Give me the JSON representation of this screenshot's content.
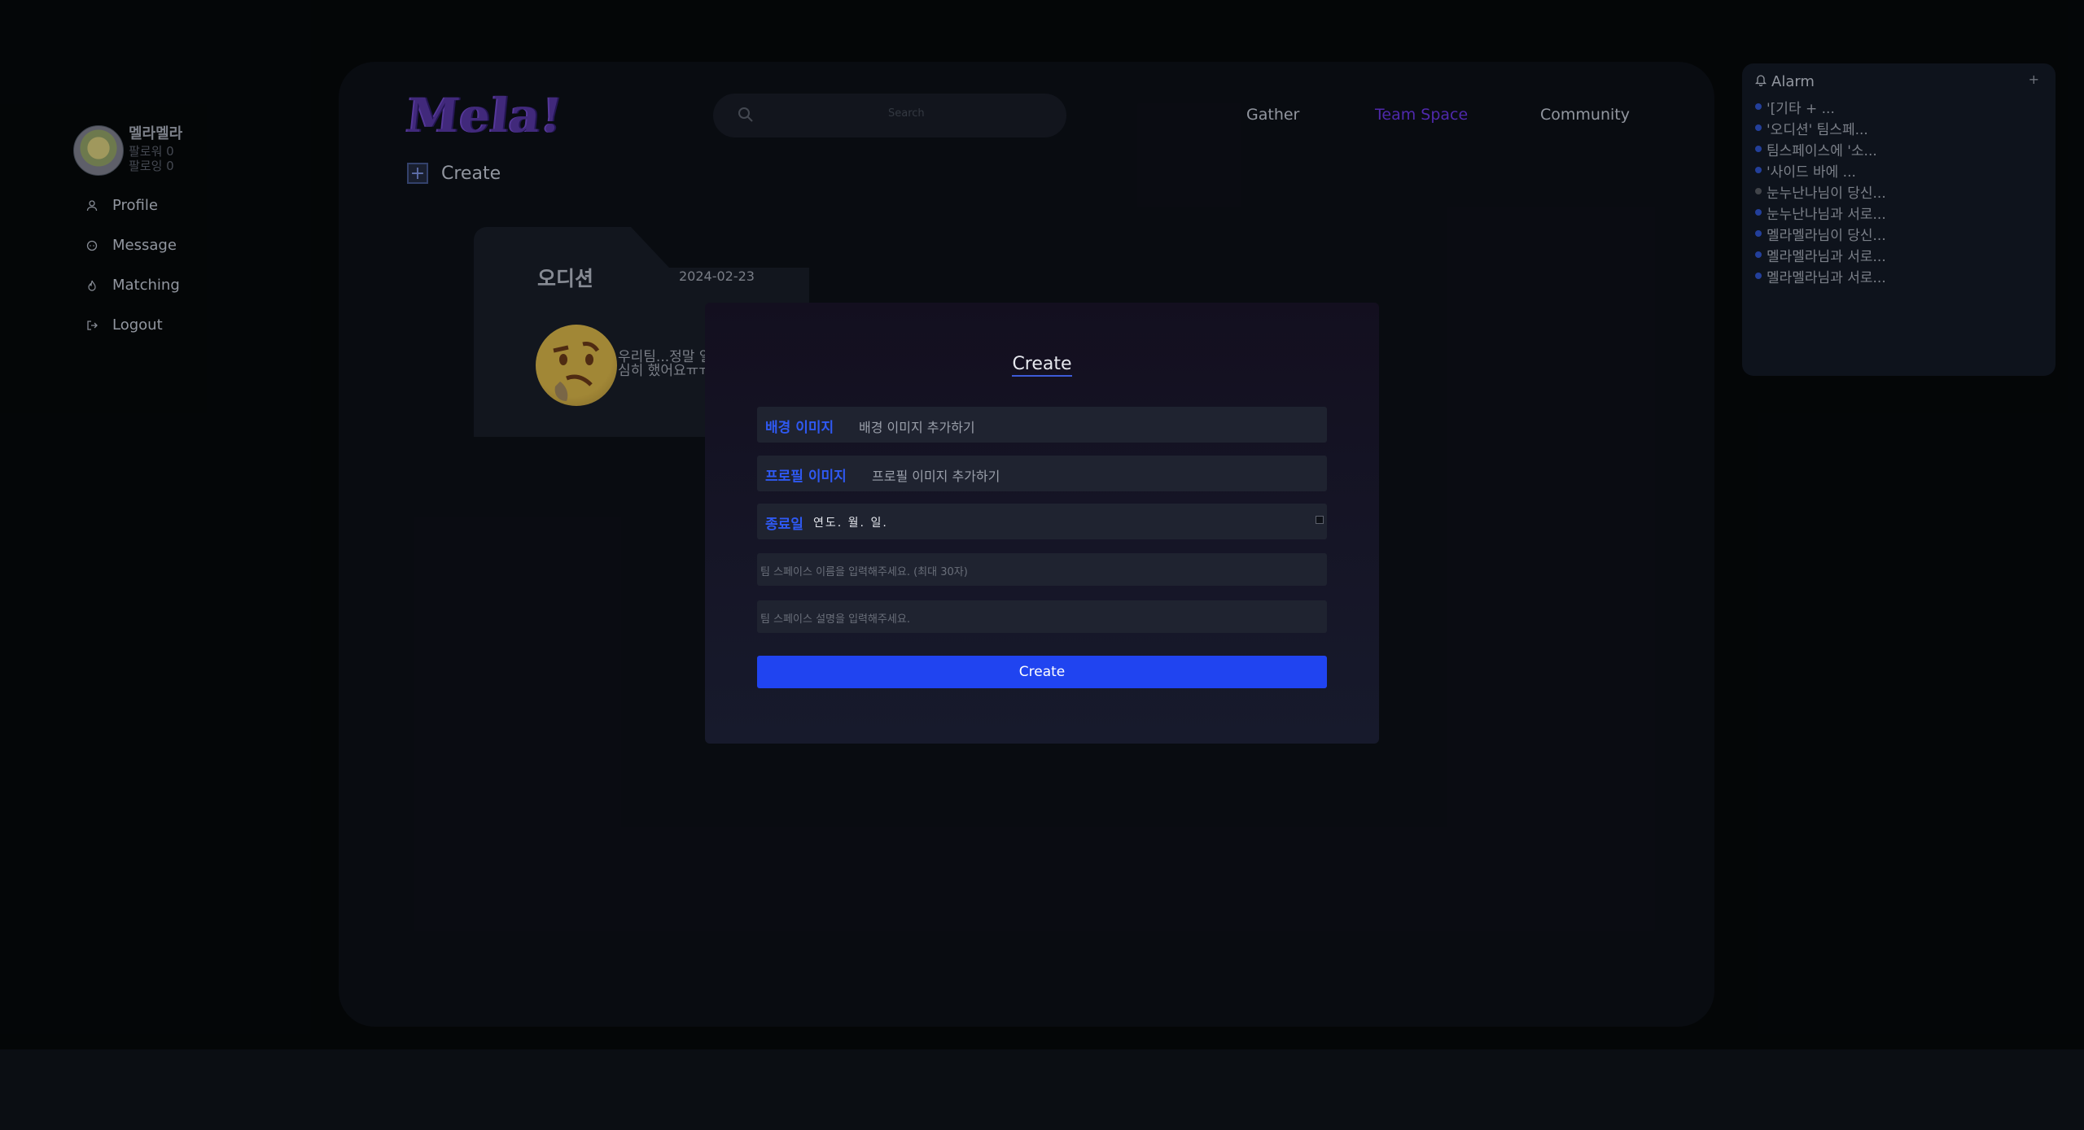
{
  "sidebar": {
    "user_name": "멜라멜라",
    "followers": "팔로워 0",
    "following": "팔로잉 0",
    "items": [
      {
        "label": "Profile",
        "icon": "person-icon"
      },
      {
        "label": "Message",
        "icon": "message-icon"
      },
      {
        "label": "Matching",
        "icon": "fire-icon"
      },
      {
        "label": "Logout",
        "icon": "logout-icon"
      }
    ]
  },
  "header": {
    "logo": "Mela!",
    "search_placeholder": "Search",
    "nav": [
      {
        "label": "Gather",
        "active": false
      },
      {
        "label": "Team Space",
        "active": true
      },
      {
        "label": "Community",
        "active": false
      }
    ],
    "nav_active_color": "#5a2fc4"
  },
  "main": {
    "create_label": "Create",
    "card": {
      "title": "오디션",
      "date": "2024-02-23",
      "description": "우리팀...정말 열심히 했어요ㅠㅠ"
    }
  },
  "alarm": {
    "title": "Alarm",
    "add_label": "+",
    "items": [
      {
        "text": "'[기타 + ...",
        "read": false
      },
      {
        "text": "'오디션' 팀스페...",
        "read": false
      },
      {
        "text": "팀스페이스에 '소...",
        "read": false
      },
      {
        "text": "'사이드 바에 ...",
        "read": false
      },
      {
        "text": "눈누난나님이 당신...",
        "read": true
      },
      {
        "text": "눈누난나님과 서로...",
        "read": false
      },
      {
        "text": "멜라멜라님이 당신...",
        "read": false
      },
      {
        "text": "멜라멜라님과 서로...",
        "read": false
      },
      {
        "text": "멜라멜라님과 서로...",
        "read": false
      }
    ]
  },
  "modal": {
    "title": "Create",
    "background_label": "배경 이미지",
    "background_value": "배경 이미지 추가하기",
    "profile_label": "프로필 이미지",
    "profile_value": "프로필 이미지 추가하기",
    "end_date_label": "종료일",
    "end_date_value": "연도. 월. 일.",
    "name_placeholder": "팀 스페이스 이름을 입력해주세요. (최대 30자)",
    "desc_placeholder": "팀 스페이스 설명을 입력해주세요.",
    "submit_label": "Create",
    "accent_color": "#2044f0"
  }
}
